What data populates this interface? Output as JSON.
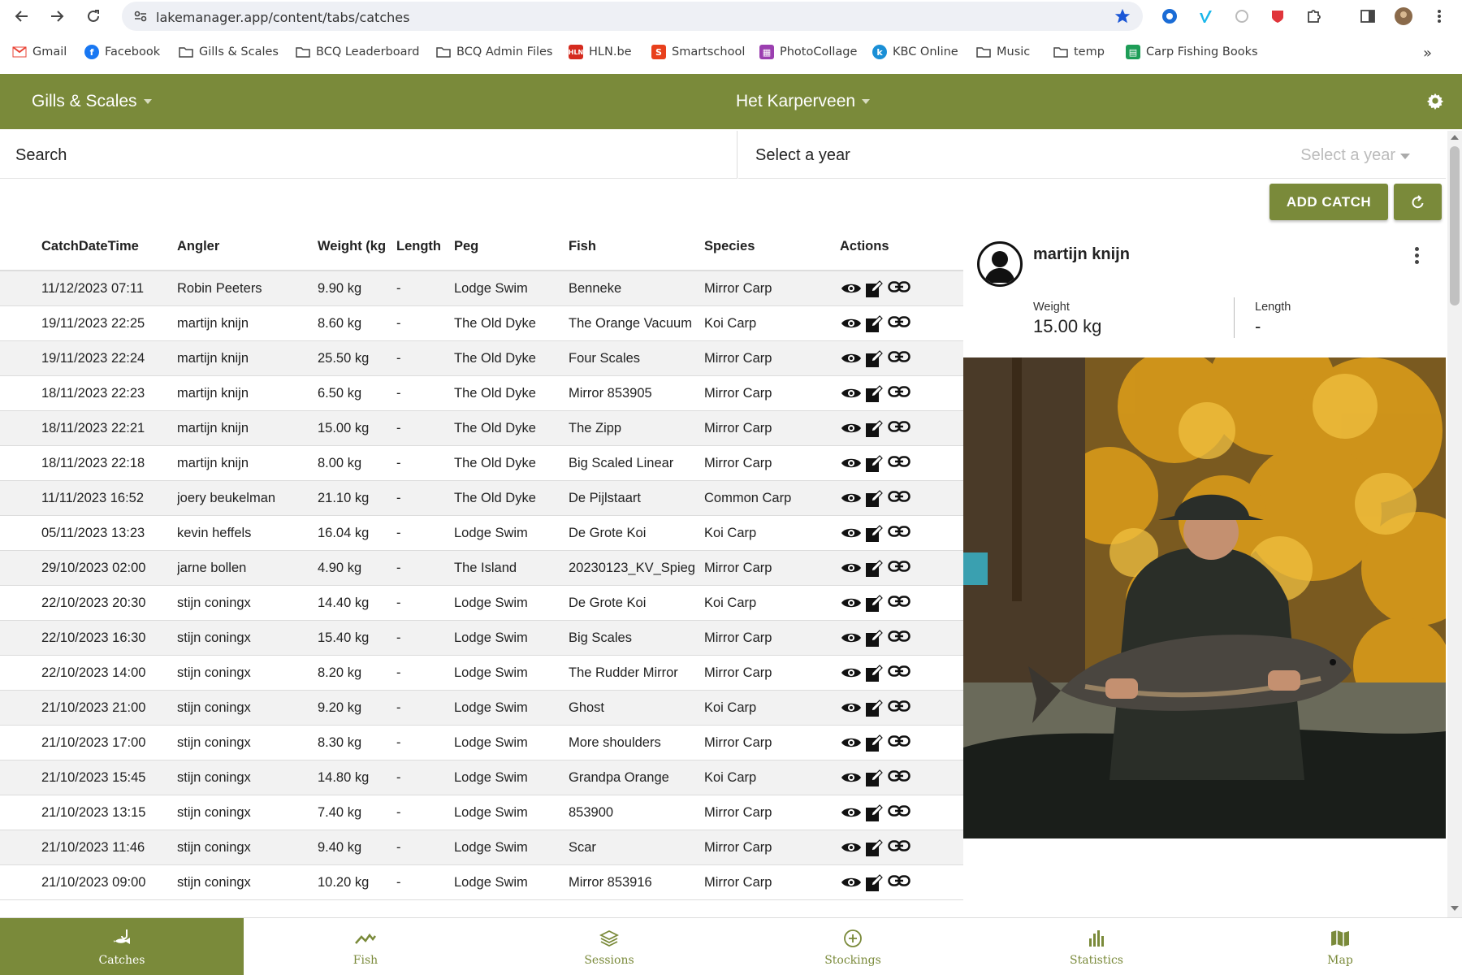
{
  "browser": {
    "url": "lakemanager.app/content/tabs/catches",
    "bookmarks": [
      {
        "label": "Gmail",
        "icon": "gmail-icon"
      },
      {
        "label": "Facebook",
        "icon": "facebook-icon"
      },
      {
        "label": "Gills & Scales",
        "icon": "folder-icon"
      },
      {
        "label": "BCQ Leaderboard",
        "icon": "folder-icon"
      },
      {
        "label": "BCQ Admin Files",
        "icon": "folder-icon"
      },
      {
        "label": "HLN.be",
        "icon": "hln-icon"
      },
      {
        "label": "Smartschool",
        "icon": "smartschool-icon"
      },
      {
        "label": "PhotoCollage",
        "icon": "photocollage-icon"
      },
      {
        "label": "KBC Online",
        "icon": "kbc-icon"
      },
      {
        "label": "Music",
        "icon": "folder-icon"
      },
      {
        "label": "temp",
        "icon": "folder-icon"
      },
      {
        "label": "Carp Fishing Books",
        "icon": "sheets-icon"
      }
    ]
  },
  "header": {
    "app_name": "Gills & Scales",
    "lake_name": "Het Karperveen",
    "accent": "#7a8a3a"
  },
  "filters": {
    "search_label": "Search",
    "year_label": "Select a year",
    "year_placeholder": "Select a year"
  },
  "toolbar": {
    "add_catch_label": "ADD CATCH"
  },
  "table": {
    "columns": [
      "CatchDateTime",
      "Angler",
      "Weight (kg",
      "Length",
      "Peg",
      "Fish",
      "Species",
      "Actions"
    ],
    "rows": [
      {
        "date": "11/12/2023 07:11",
        "angler": "Robin Peeters",
        "weight": "9.90 kg",
        "length": "-",
        "peg": "Lodge Swim",
        "fish": "Benneke",
        "species": "Mirror Carp"
      },
      {
        "date": "19/11/2023 22:25",
        "angler": "martijn knijn",
        "weight": "8.60 kg",
        "length": "-",
        "peg": "The Old Dyke",
        "fish": "The Orange Vacuum",
        "species": "Koi Carp"
      },
      {
        "date": "19/11/2023 22:24",
        "angler": "martijn knijn",
        "weight": "25.50 kg",
        "length": "-",
        "peg": "The Old Dyke",
        "fish": "Four Scales",
        "species": "Mirror Carp"
      },
      {
        "date": "18/11/2023 22:23",
        "angler": "martijn knijn",
        "weight": "6.50 kg",
        "length": "-",
        "peg": "The Old Dyke",
        "fish": "Mirror 853905",
        "species": "Mirror Carp"
      },
      {
        "date": "18/11/2023 22:21",
        "angler": "martijn knijn",
        "weight": "15.00 kg",
        "length": "-",
        "peg": "The Old Dyke",
        "fish": "The Zipp",
        "species": "Mirror Carp"
      },
      {
        "date": "18/11/2023 22:18",
        "angler": "martijn knijn",
        "weight": "8.00 kg",
        "length": "-",
        "peg": "The Old Dyke",
        "fish": "Big Scaled Linear",
        "species": "Mirror Carp"
      },
      {
        "date": "11/11/2023 16:52",
        "angler": "joery beukelman",
        "weight": "21.10 kg",
        "length": "-",
        "peg": "The Old Dyke",
        "fish": "De Pijlstaart",
        "species": "Common Carp"
      },
      {
        "date": "05/11/2023 13:23",
        "angler": "kevin heffels",
        "weight": "16.04 kg",
        "length": "-",
        "peg": "Lodge Swim",
        "fish": "De Grote Koi",
        "species": "Koi Carp"
      },
      {
        "date": "29/10/2023 02:00",
        "angler": "jarne bollen",
        "weight": "4.90 kg",
        "length": "-",
        "peg": "The Island",
        "fish": "20230123_KV_Spieg",
        "species": "Mirror Carp"
      },
      {
        "date": "22/10/2023 20:30",
        "angler": "stijn coningx",
        "weight": "14.40 kg",
        "length": "-",
        "peg": "Lodge Swim",
        "fish": "De Grote Koi",
        "species": "Koi Carp"
      },
      {
        "date": "22/10/2023 16:30",
        "angler": "stijn coningx",
        "weight": "15.40 kg",
        "length": "-",
        "peg": "Lodge Swim",
        "fish": "Big Scales",
        "species": "Mirror Carp"
      },
      {
        "date": "22/10/2023 14:00",
        "angler": "stijn coningx",
        "weight": "8.20 kg",
        "length": "-",
        "peg": "Lodge Swim",
        "fish": "The Rudder Mirror",
        "species": "Mirror Carp"
      },
      {
        "date": "21/10/2023 21:00",
        "angler": "stijn coningx",
        "weight": "9.20 kg",
        "length": "-",
        "peg": "Lodge Swim",
        "fish": "Ghost",
        "species": "Koi Carp"
      },
      {
        "date": "21/10/2023 17:00",
        "angler": "stijn coningx",
        "weight": "8.30 kg",
        "length": "-",
        "peg": "Lodge Swim",
        "fish": "More shoulders",
        "species": "Mirror Carp"
      },
      {
        "date": "21/10/2023 15:45",
        "angler": "stijn coningx",
        "weight": "14.80 kg",
        "length": "-",
        "peg": "Lodge Swim",
        "fish": "Grandpa Orange",
        "species": "Koi Carp"
      },
      {
        "date": "21/10/2023 13:15",
        "angler": "stijn coningx",
        "weight": "7.40 kg",
        "length": "-",
        "peg": "Lodge Swim",
        "fish": "853900",
        "species": "Mirror Carp"
      },
      {
        "date": "21/10/2023 11:46",
        "angler": "stijn coningx",
        "weight": "9.40 kg",
        "length": "-",
        "peg": "Lodge Swim",
        "fish": "Scar",
        "species": "Mirror Carp"
      },
      {
        "date": "21/10/2023 09:00",
        "angler": "stijn coningx",
        "weight": "10.20 kg",
        "length": "-",
        "peg": "Lodge Swim",
        "fish": "Mirror 853916",
        "species": "Mirror Carp"
      }
    ]
  },
  "detail": {
    "angler": "martijn knijn",
    "weight_label": "Weight",
    "weight_value": "15.00 kg",
    "length_label": "Length",
    "length_value": "-"
  },
  "tabs": [
    {
      "label": "Catches",
      "icon": "fish-hook-icon",
      "active": true
    },
    {
      "label": "Fish",
      "icon": "trend-icon",
      "active": false
    },
    {
      "label": "Sessions",
      "icon": "layers-icon",
      "active": false
    },
    {
      "label": "Stockings",
      "icon": "add-circle-icon",
      "active": false
    },
    {
      "label": "Statistics",
      "icon": "bar-chart-icon",
      "active": false
    },
    {
      "label": "Map",
      "icon": "map-icon",
      "active": false
    }
  ]
}
